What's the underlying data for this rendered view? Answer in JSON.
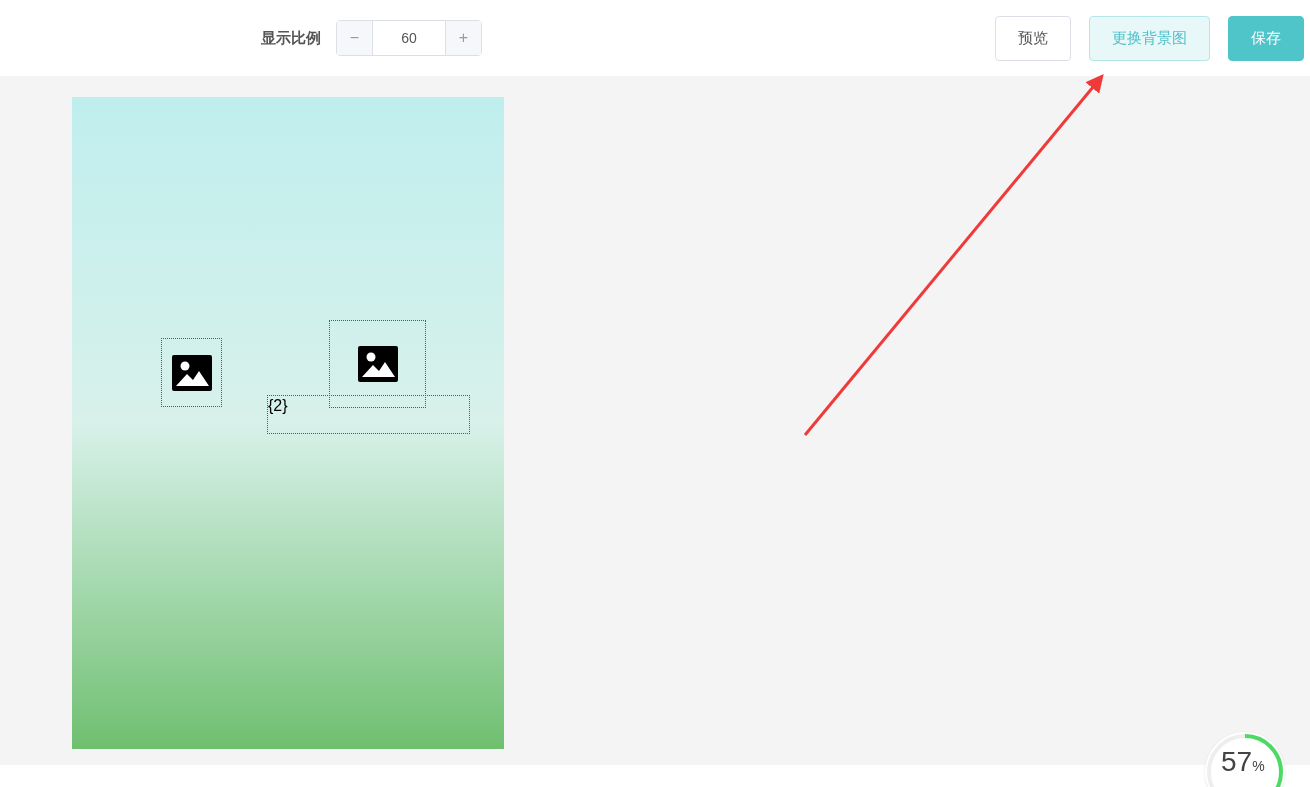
{
  "toolbar": {
    "scale_label": "显示比例",
    "scale_value": "60",
    "decrement": "−",
    "increment": "+",
    "buttons": [
      {
        "label": "预览",
        "kind": "default"
      },
      {
        "label": "更换背景图",
        "kind": "light"
      },
      {
        "label": "保存",
        "kind": "primary"
      }
    ]
  },
  "canvas": {
    "elements": [
      {
        "kind": "image"
      },
      {
        "kind": "image"
      },
      {
        "kind": "text",
        "text": "{2}"
      }
    ]
  },
  "speed_widget": {
    "value": "57",
    "unit": "%"
  }
}
